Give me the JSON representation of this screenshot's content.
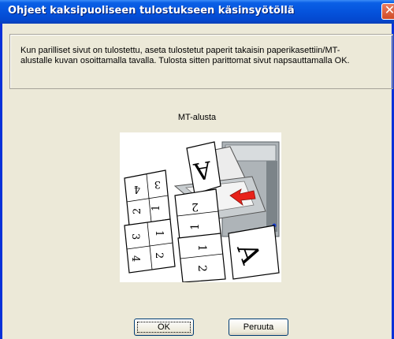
{
  "window": {
    "title": "Ohjeet kaksipuoliseen tulostukseen käsinsyötöllä",
    "close_symbol": "✕"
  },
  "message": "Kun parilliset sivut on tulostettu, aseta tulostetut paperit takaisin paperikasettiin/MT-alustalle kuvan osoittamalla tavalla. Tulosta sitten parittomat sivut napsauttamalla OK.",
  "illustration": {
    "caption": "MT-alusta",
    "icon": "printer-mp-tray-icon"
  },
  "buttons": {
    "ok": "OK",
    "cancel": "Peruuta"
  },
  "colors": {
    "titlebar": "#0553dc",
    "window_bg": "#ece9d8",
    "close": "#d04b26",
    "arrow": "#e8221a"
  }
}
